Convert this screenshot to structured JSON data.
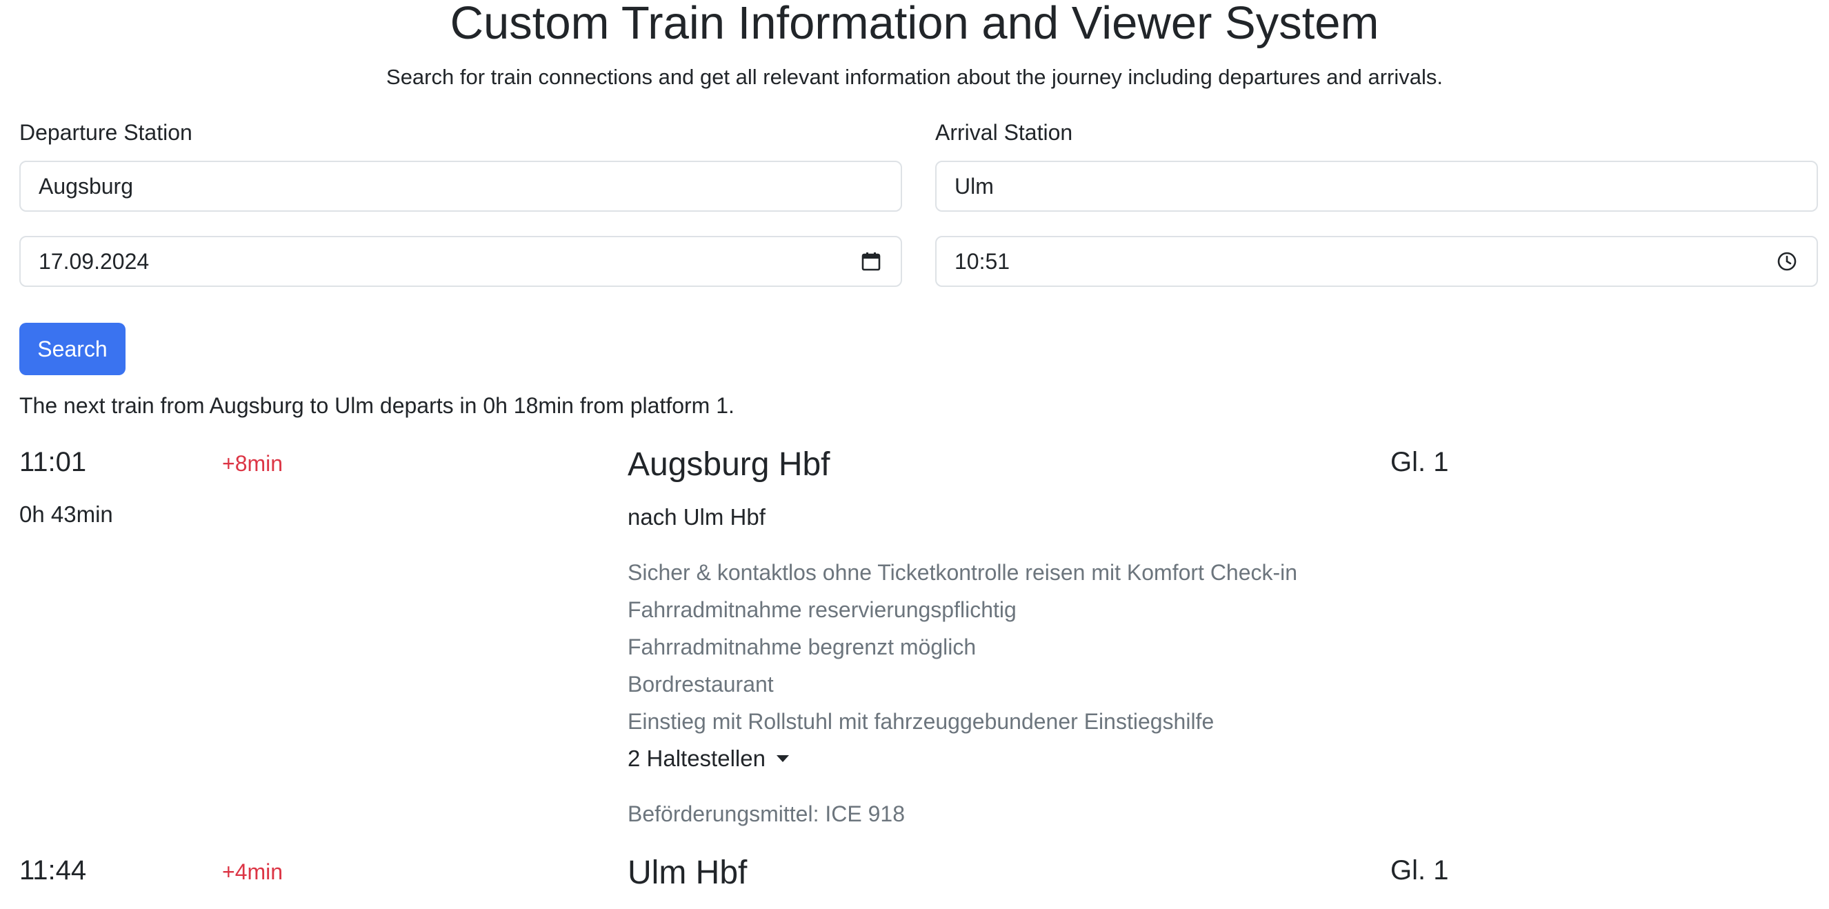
{
  "page": {
    "title": "Custom Train Information and Viewer System",
    "subtitle": "Search for train connections and get all relevant information about the journey including departures and arrivals."
  },
  "form": {
    "departure_label": "Departure Station",
    "departure_value": "Augsburg",
    "arrival_label": "Arrival Station",
    "arrival_value": "Ulm",
    "date_value": "17.09.2024",
    "time_value": "10:51",
    "search_label": "Search"
  },
  "summary": "The next train from Augsburg to Ulm departs in 0h 18min from platform 1.",
  "connection": {
    "departure": {
      "time": "11:01",
      "delay": "+8min",
      "station": "Augsburg Hbf",
      "platform": "Gl. 1",
      "duration": "0h 43min",
      "destination": "nach Ulm Hbf"
    },
    "info": [
      "Sicher & kontaktlos ohne Ticketkontrolle reisen mit Komfort Check-in",
      "Fahrradmitnahme reservierungspflichtig",
      "Fahrradmitnahme begrenzt möglich",
      "Bordrestaurant",
      "Einstieg mit Rollstuhl mit fahrzeuggebundener Einstiegshilfe"
    ],
    "stops_label": "2 Haltestellen",
    "transport": "Beförderungsmittel: ICE 918",
    "arrival": {
      "time": "11:44",
      "delay": "+4min",
      "station": "Ulm Hbf",
      "platform": "Gl. 1"
    }
  },
  "icons": {
    "date": "calendar-icon",
    "time": "clock-icon",
    "stops": "caret-down-icon"
  },
  "colors": {
    "primary": "#3a73f0",
    "delay": "#dc3545",
    "muted": "#6c757d"
  }
}
